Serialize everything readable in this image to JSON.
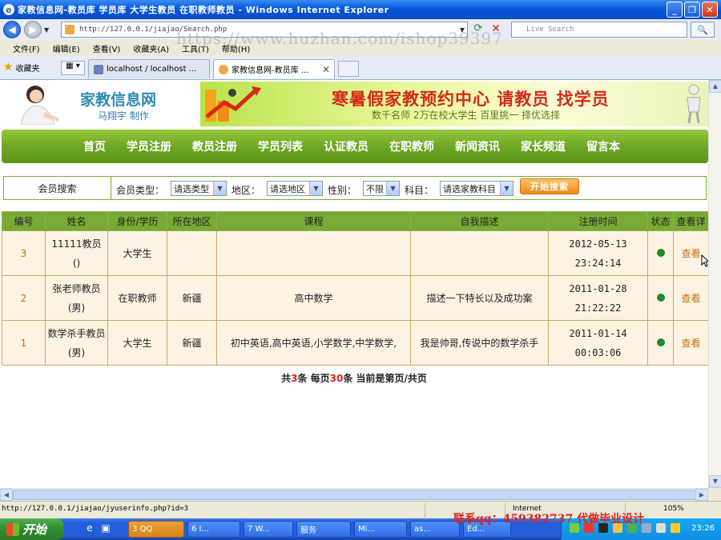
{
  "window": {
    "title": "家教信息网-教员库 学员库 大学生教员 在职教师教员 - Windows Internet Explorer"
  },
  "browser": {
    "address": "http://127.0.0.1/jiajao/Search.php",
    "search_placeholder": "Live Search",
    "menu": [
      "文件(F)",
      "编辑(E)",
      "查看(V)",
      "收藏夹(A)",
      "工具(T)",
      "帮助(H)"
    ],
    "favorites_label": "收藏夹",
    "tabs": [
      {
        "label": "localhost / localhost ...",
        "active": false
      },
      {
        "label": "家教信息网-教员库 ...",
        "active": true
      }
    ],
    "status_url": "http://127.0.0.1/jiajao/jyuserinfo.php?id=3",
    "status_zone": "Internet",
    "status_zoom": "105%"
  },
  "site": {
    "brand": "家教信息网",
    "author": "马翔宇 制作",
    "banner_title": "寒暑假家教预约中心 请教员 找学员",
    "banner_sub": "数千名师 2万在校大学生 百里挑一 择优选择",
    "nav": [
      "首页",
      "学员注册",
      "教员注册",
      "学员列表",
      "认证教员",
      "在职教师",
      "新闻资讯",
      "家长频道",
      "留言本"
    ]
  },
  "search": {
    "title": "会员搜索",
    "type_label": "会员类型：",
    "type_value": "请选类型",
    "area_label": "地区：",
    "area_value": "请选地区",
    "gender_label": "性别：",
    "gender_value": "不限",
    "subject_label": "科目：",
    "subject_value": "请选家教科目",
    "go_label": "开始搜索"
  },
  "table": {
    "headers": [
      "编号",
      "姓名",
      "身份/学历",
      "所在地区",
      "课程",
      "自我描述",
      "注册时间",
      "状态",
      "查看详"
    ],
    "rows": [
      {
        "id": "3",
        "name1": "11111教员",
        "name2": "()",
        "identity": "大学生",
        "area": "",
        "course": "",
        "desc": "",
        "time": "2012-05-13 23:24:14",
        "status": "active",
        "view": "查看"
      },
      {
        "id": "2",
        "name1": "张老师教员",
        "name2": "(男)",
        "identity": "在职教师",
        "area": "新疆",
        "course": "高中数学",
        "desc": "描述一下特长以及成功案",
        "time": "2011-01-28 21:22:22",
        "status": "active",
        "view": "查看"
      },
      {
        "id": "1",
        "name1": "数学杀手教员",
        "name2": "(男)",
        "identity": "大学生",
        "area": "新疆",
        "course": "初中英语,高中英语,小学数学,中学数学,",
        "desc": "我是帅哥,传说中的数学杀手",
        "time": "2011-01-14 00:03:06",
        "status": "active",
        "view": "查看"
      }
    ],
    "status_color": "#1c8a2a"
  },
  "pager": {
    "total_prefix": "共",
    "total": "3",
    "total_suffix": "条  每页",
    "per_page": "30",
    "per_page_suffix": "条  当前是第页/共页"
  },
  "taskbar": {
    "start_label": "开始",
    "buttons": [
      "3 QQ",
      "6 I...",
      "7 W...",
      "服务",
      "Mi...",
      "as...",
      "Ed..."
    ],
    "clock": "23:26"
  },
  "overlay": {
    "watermark": "https://www.huzhan.com/ishop39397",
    "promo": "联系qq：459382737 代做毕业设计"
  },
  "colors": {
    "nav_green": "#6ea724",
    "accent_orange": "#c97013",
    "banner_red": "#d6281a"
  }
}
